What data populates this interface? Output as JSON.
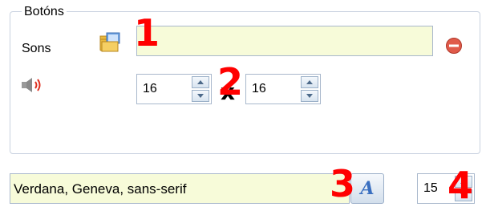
{
  "group": {
    "legend": "Botóns"
  },
  "sounds": {
    "label": "Sons",
    "value": ""
  },
  "icons": {
    "folder": "folder-browse-icon",
    "remove": "remove-icon",
    "speaker": "speaker-icon"
  },
  "size": {
    "width": "16",
    "separator": "x",
    "height": "16"
  },
  "font": {
    "value": "Verdana, Geneva, sans-serif",
    "size": "15"
  },
  "callouts": [
    "1",
    "2",
    "3",
    "4"
  ],
  "colors": {
    "callout": "#ff0000",
    "field_bg": "#f7fbd9",
    "border": "#a9b8cc"
  }
}
